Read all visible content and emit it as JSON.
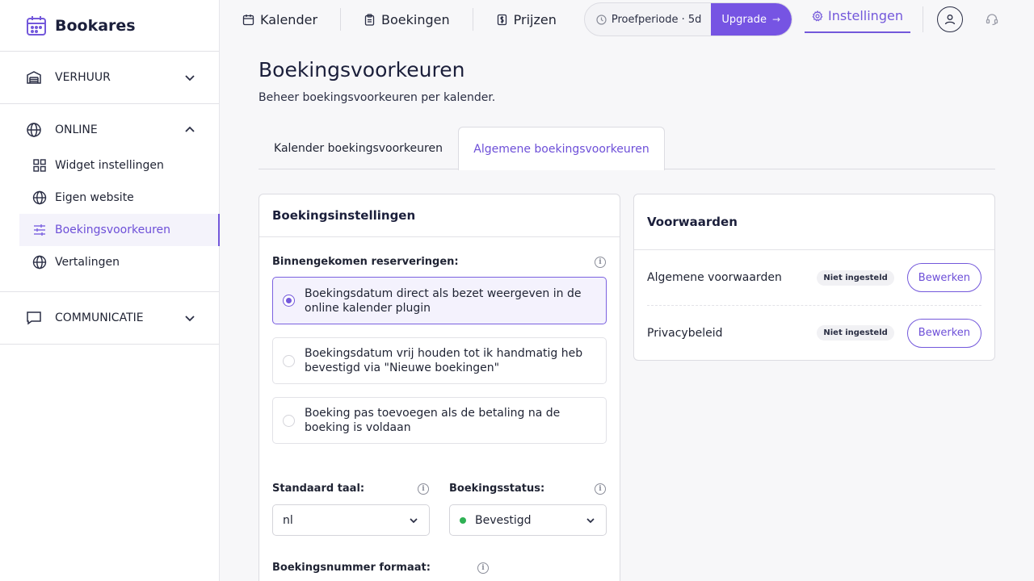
{
  "brand": {
    "name": "Bookares"
  },
  "sidebar": {
    "sections": [
      {
        "label": "VERHUUR",
        "icon": "warehouse-icon",
        "expanded": false
      },
      {
        "label": "ONLINE",
        "icon": "globe-icon",
        "expanded": true,
        "items": [
          {
            "label": "Widget instellingen",
            "icon": "grid-icon"
          },
          {
            "label": "Eigen website",
            "icon": "globe-icon"
          },
          {
            "label": "Boekingsvoorkeuren",
            "icon": "sliders-icon",
            "active": true
          },
          {
            "label": "Vertalingen",
            "icon": "globe-icon"
          }
        ]
      },
      {
        "label": "COMMUNICATIE",
        "icon": "chat-icon",
        "expanded": false
      }
    ]
  },
  "topbar": {
    "nav": [
      {
        "label": "Kalender",
        "icon": "calendar-icon"
      },
      {
        "label": "Boekingen",
        "icon": "clipboard-icon"
      },
      {
        "label": "Prijzen",
        "icon": "price-tag-icon"
      }
    ],
    "trial_label": "Proefperiode · 5d",
    "upgrade_label": "Upgrade",
    "settings_label": "Instellingen"
  },
  "page": {
    "title": "Boekingsvoorkeuren",
    "subtitle": "Beheer boekingsvoorkeuren per kalender.",
    "tabs": [
      {
        "label": "Kalender boekingsvoorkeuren",
        "active": false
      },
      {
        "label": "Algemene boekingsvoorkeuren",
        "active": true
      }
    ]
  },
  "booking_settings": {
    "title": "Boekingsinstellingen",
    "incoming_label": "Binnengekomen reserveringen:",
    "options": [
      {
        "label": "Boekingsdatum direct als bezet weergeven in de online kalender plugin",
        "selected": true
      },
      {
        "label": "Boekingsdatum vrij houden tot ik handmatig heb bevestigd via \"Nieuwe boekingen\"",
        "selected": false
      },
      {
        "label": "Boeking pas toevoegen als de betaling na de boeking is voldaan",
        "selected": false
      }
    ],
    "language_label": "Standaard taal:",
    "language_value": "nl",
    "status_label": "Boekingsstatus:",
    "status_value": "Bevestigd",
    "status_color": "#2fb154",
    "number_format_label": "Boekingsnummer formaat:"
  },
  "terms": {
    "title": "Voorwaarden",
    "rows": [
      {
        "label": "Algemene voorwaarden",
        "status": "Niet ingesteld",
        "action": "Bewerken"
      },
      {
        "label": "Privacybeleid",
        "status": "Niet ingesteld",
        "action": "Bewerken"
      }
    ]
  },
  "colors": {
    "accent": "#7358db",
    "upgrade": "#7654e3"
  }
}
